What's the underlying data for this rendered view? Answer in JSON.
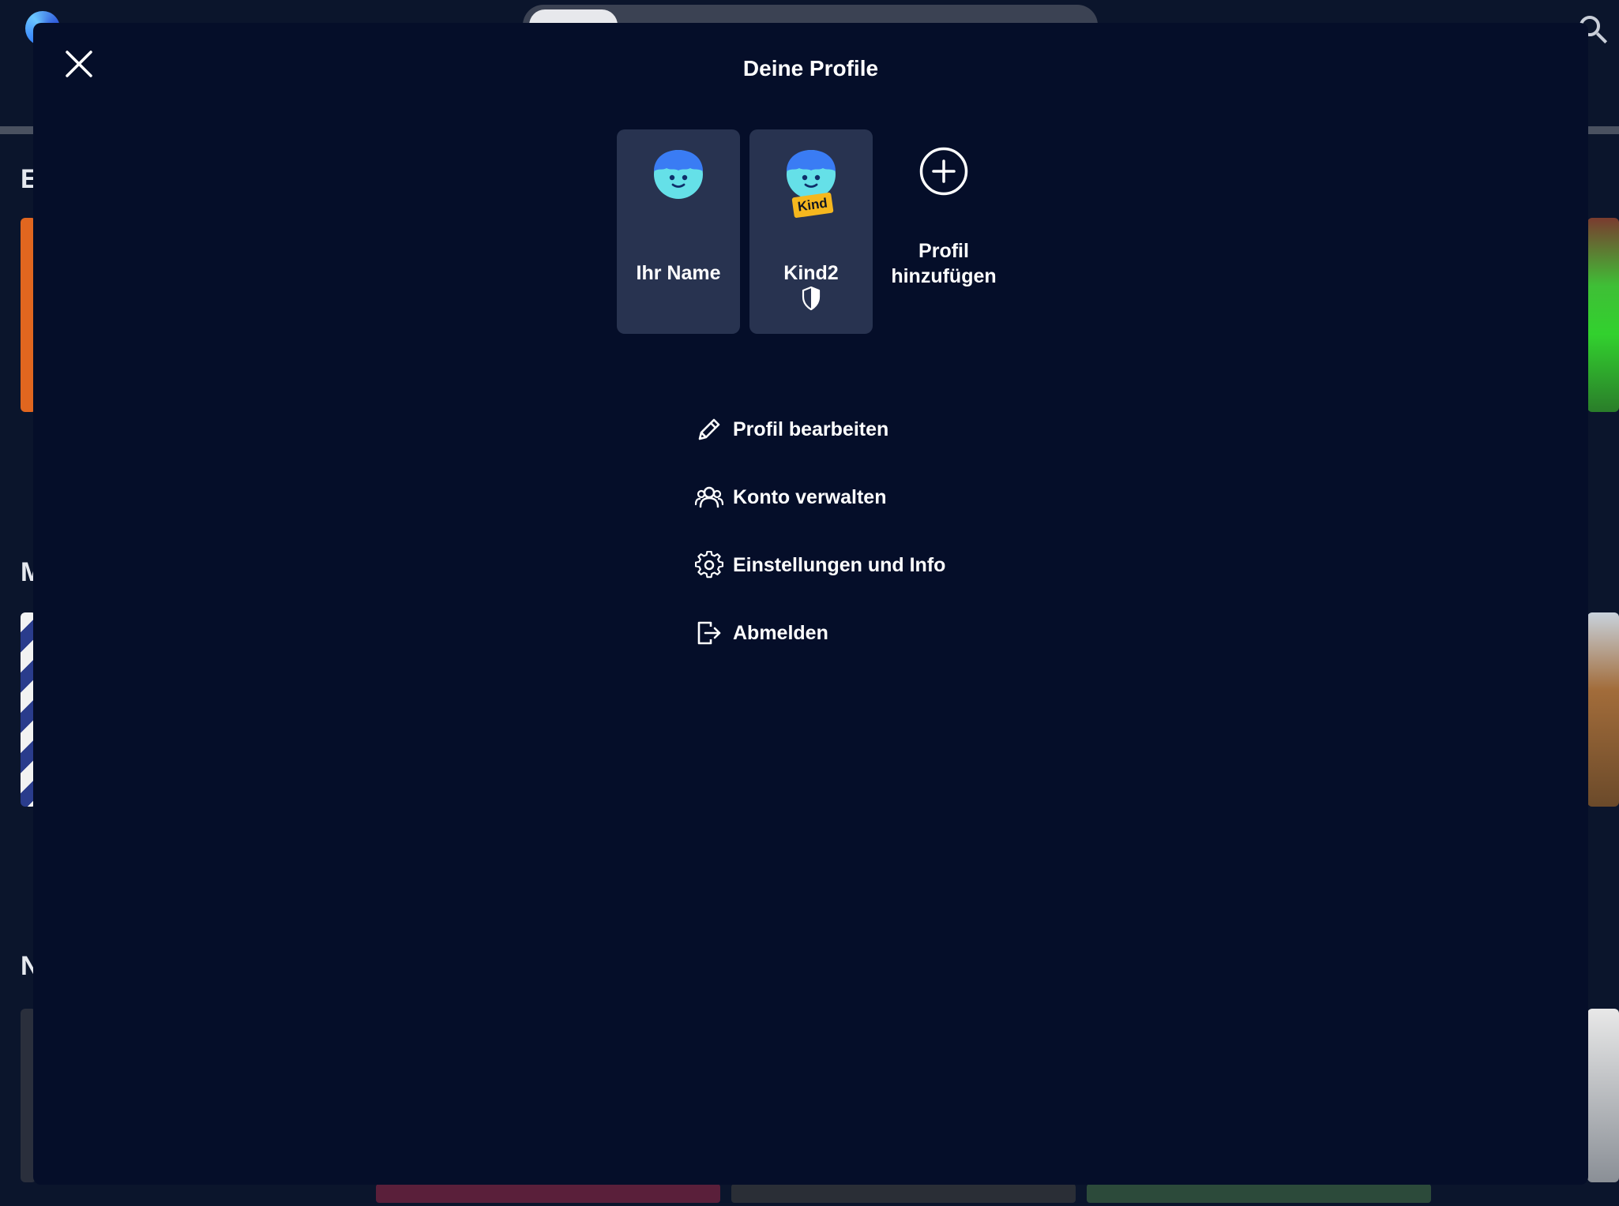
{
  "modal": {
    "title": "Deine Profile",
    "close_icon": "close-icon"
  },
  "profiles": [
    {
      "name": "Ihr Name",
      "avatar_icon": "face-avatar-icon",
      "kids": false
    },
    {
      "name": "Kind2",
      "avatar_icon": "face-avatar-icon",
      "badge": "Kind",
      "kids": true,
      "protection_icon": "shield-icon"
    }
  ],
  "add_profile": {
    "line1": "Profil",
    "line2": "hinzufügen",
    "icon": "plus-circle-icon"
  },
  "menu": {
    "items": [
      {
        "label": "Profil bearbeiten",
        "icon": "pencil-icon"
      },
      {
        "label": "Konto verwalten",
        "icon": "users-icon"
      },
      {
        "label": "Einstellungen und Info",
        "icon": "gear-icon"
      },
      {
        "label": "Abmelden",
        "icon": "logout-icon"
      }
    ]
  },
  "colors": {
    "modal_background": "#050e29",
    "card_background": "#283350",
    "avatar": "#65e0e8",
    "avatar_hair": "#3a7cf4",
    "kind_badge": "#f5b71e",
    "text": "#ffffff"
  }
}
